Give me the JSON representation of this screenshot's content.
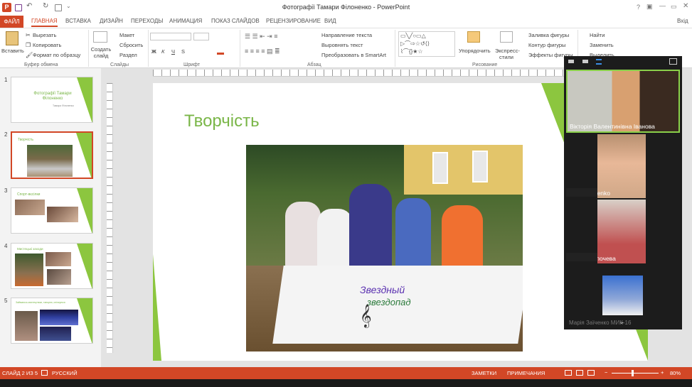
{
  "app": {
    "window_title": "Фотографії Тамари Філоненко - PowerPoint",
    "account": "Вхід"
  },
  "tabs": [
    "ФАЙЛ",
    "ГЛАВНАЯ",
    "ВСТАВКА",
    "ДИЗАЙН",
    "ПЕРЕХОДЫ",
    "АНИМАЦИЯ",
    "ПОКАЗ СЛАЙДОВ",
    "РЕЦЕНЗИРОВАНИЕ",
    "ВИД"
  ],
  "ribbon": {
    "clipboard": {
      "paste": "Вставить",
      "cut": "Вырезать",
      "copy": "Копировать",
      "format_painter": "Формат по образцу",
      "group": "Буфер обмена"
    },
    "slides": {
      "new_slide": "Создать слайд",
      "layout": "Макет",
      "reset": "Сбросить",
      "section": "Раздел",
      "group": "Слайды"
    },
    "font": {
      "group": "Шрифт",
      "bold": "Ж",
      "italic": "К",
      "underline": "Ч",
      "strike": "S"
    },
    "paragraph": {
      "text_direction": "Направление текста",
      "align_text": "Выровнять текст",
      "smartart": "Преобразовать в SmartArt",
      "group": "Абзац"
    },
    "drawing": {
      "arrange": "Упорядочить",
      "quick_styles": "Экспресс-стили",
      "fill": "Заливка фигуры",
      "outline": "Контур фигуры",
      "effects": "Эффекты фигуры",
      "group": "Рисование"
    },
    "editing": {
      "find": "Найти",
      "replace": "Заменить",
      "select": "Выделить"
    }
  },
  "slides": [
    {
      "num": "1",
      "title": "Фотографії Тамари Філоненко",
      "subtitle": "Тамара Філоненко"
    },
    {
      "num": "2",
      "title": "Творчість"
    },
    {
      "num": "3",
      "title": "Спорт-вєсілки"
    },
    {
      "num": "4",
      "title": "Мистецькі заходи"
    },
    {
      "num": "5",
      "title": "Займаюсь мистецтвом, танцюю, спілкуюся"
    }
  ],
  "current_slide": {
    "title": "Творчість",
    "photo_caption_line1": "Звездный",
    "photo_caption_line2": "звездопад"
  },
  "statusbar": {
    "slide_info": "СЛАЙД 2 ИЗ 5",
    "language": "РУССКИЙ",
    "notes": "ЗАМЕТКИ",
    "comments": "ПРИМЕЧАНИЯ",
    "zoom": "80%"
  },
  "zoom_participants": [
    {
      "name": "Вікторія Валентинівна Іванова"
    },
    {
      "name": "Toma Filonenko"
    },
    {
      "name": "Настя Кропочева"
    },
    {
      "name": "Марія Заїченко МИК-16"
    }
  ],
  "colors": {
    "accent": "#d24726",
    "slide_green": "#7ab648"
  }
}
